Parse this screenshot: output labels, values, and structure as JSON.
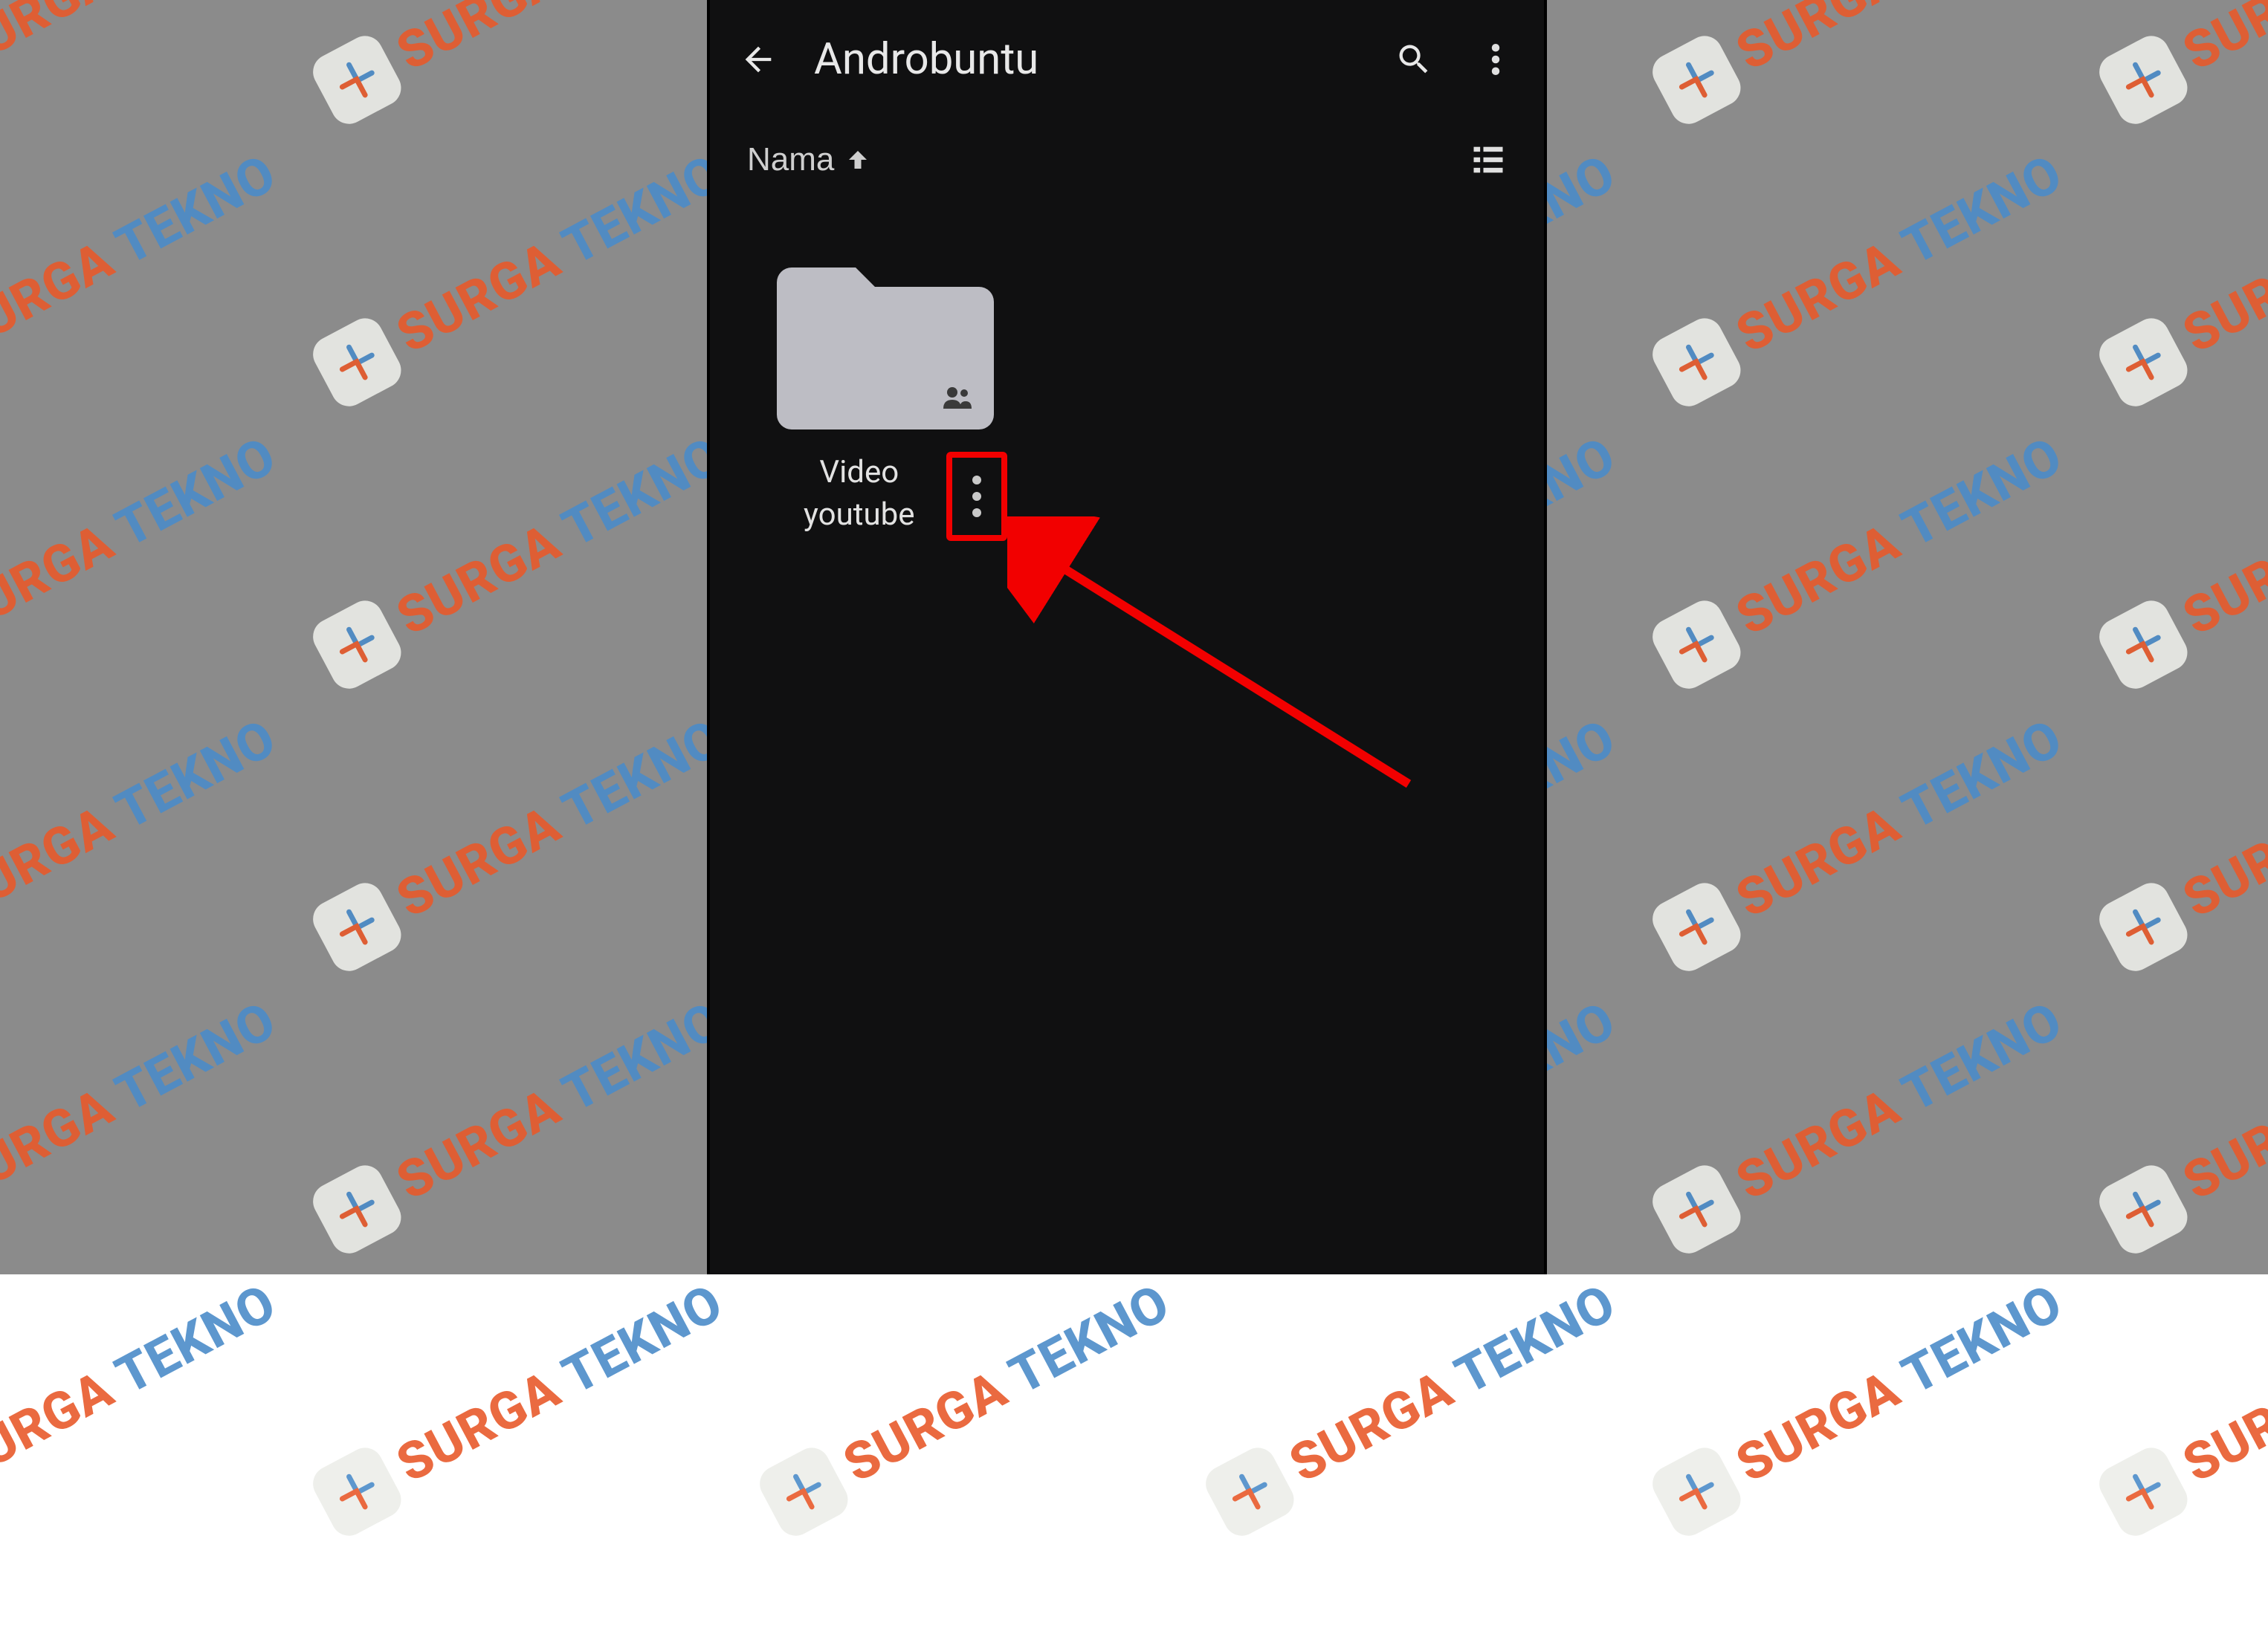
{
  "watermark": {
    "brand_part1": "SURGA",
    "brand_part2": "TEKNO"
  },
  "appbar": {
    "title": "Androbuntu"
  },
  "sort": {
    "label": "Nama"
  },
  "folder": {
    "name": "Video\nyoutube"
  },
  "annotation": {
    "highlight_color": "#f20000"
  }
}
